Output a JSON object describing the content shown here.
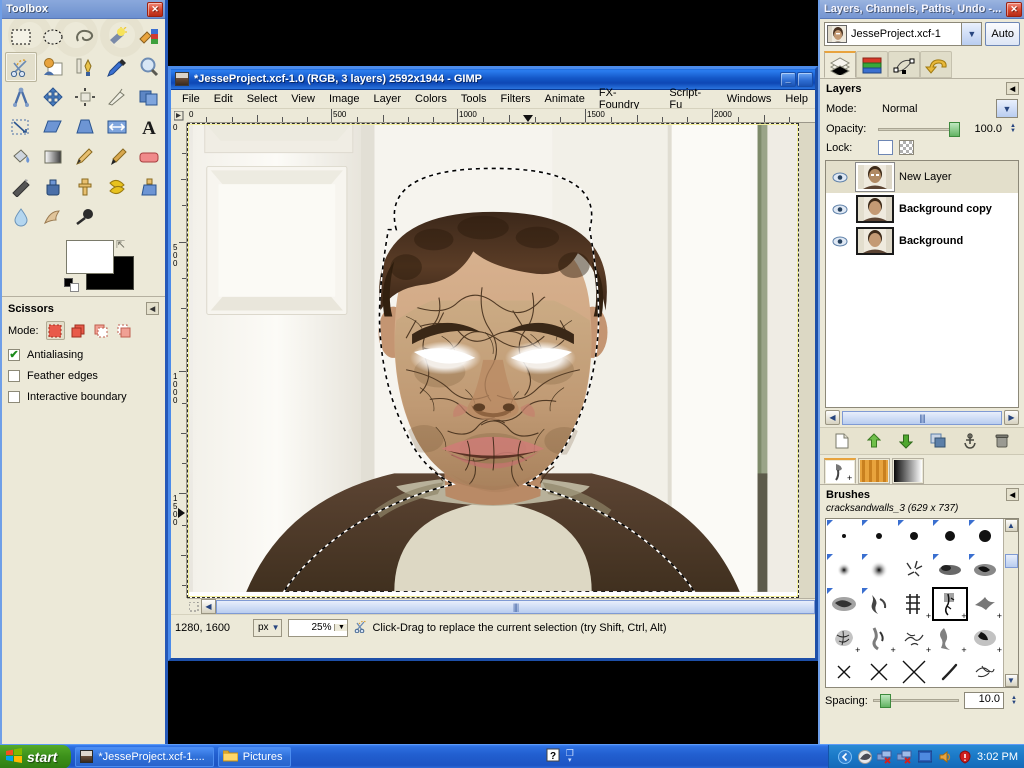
{
  "app": {
    "name": "GIMP",
    "accent": "#1d4fa8",
    "panel_bg": "#ece9d8"
  },
  "toolbox": {
    "title": "Toolbox",
    "close_label": "✕",
    "tools": [
      {
        "name": "rect-select-tool",
        "icon": "rect-select-icon"
      },
      {
        "name": "ellipse-select-tool",
        "icon": "ellipse-select-icon"
      },
      {
        "name": "free-select-tool",
        "icon": "lasso-icon"
      },
      {
        "name": "fuzzy-select-tool",
        "icon": "magic-wand-icon"
      },
      {
        "name": "select-by-color-tool",
        "icon": "color-select-icon"
      },
      {
        "name": "scissors-select-tool",
        "icon": "scissors-icon"
      },
      {
        "name": "foreground-select-tool",
        "icon": "foreground-select-icon"
      },
      {
        "name": "paths-tool",
        "icon": "pen-path-icon"
      },
      {
        "name": "color-picker-tool",
        "icon": "eyedropper-icon"
      },
      {
        "name": "zoom-tool",
        "icon": "magnifier-icon"
      },
      {
        "name": "measure-tool",
        "icon": "compass-icon"
      },
      {
        "name": "move-tool",
        "icon": "move-arrows-icon"
      },
      {
        "name": "align-tool",
        "icon": "align-icon"
      },
      {
        "name": "crop-tool",
        "icon": "crop-knife-icon"
      },
      {
        "name": "rotate-tool",
        "icon": "rotate-icon"
      },
      {
        "name": "scale-tool",
        "icon": "scale-icon"
      },
      {
        "name": "shear-tool",
        "icon": "shear-icon"
      },
      {
        "name": "perspective-tool",
        "icon": "perspective-icon"
      },
      {
        "name": "flip-tool",
        "icon": "flip-icon"
      },
      {
        "name": "text-tool",
        "icon": "text-a-icon"
      },
      {
        "name": "bucket-fill-tool",
        "icon": "bucket-fill-icon"
      },
      {
        "name": "blend-tool",
        "icon": "gradient-icon"
      },
      {
        "name": "pencil-tool",
        "icon": "pencil-icon"
      },
      {
        "name": "paintbrush-tool",
        "icon": "paintbrush-icon"
      },
      {
        "name": "eraser-tool",
        "icon": "eraser-icon"
      },
      {
        "name": "airbrush-tool",
        "icon": "airbrush-icon"
      },
      {
        "name": "ink-tool",
        "icon": "ink-icon"
      },
      {
        "name": "clone-tool",
        "icon": "clone-stamp-icon"
      },
      {
        "name": "heal-tool",
        "icon": "heal-icon"
      },
      {
        "name": "perspective-clone-tool",
        "icon": "perspective-clone-icon"
      },
      {
        "name": "blur-sharpen-tool",
        "icon": "waterdrop-icon"
      },
      {
        "name": "smudge-tool",
        "icon": "smudge-finger-icon"
      },
      {
        "name": "dodge-burn-tool",
        "icon": "dodge-burn-icon"
      }
    ],
    "active_tool_index": 5,
    "colors": {
      "foreground": "#ffffff",
      "background": "#000000"
    },
    "tool_options": {
      "title": "Scissors",
      "mode_label": "Mode:",
      "modes": [
        "replace",
        "add",
        "subtract",
        "intersect"
      ],
      "selected_mode": 0,
      "checkboxes": [
        {
          "label": "Antialiasing",
          "checked": true
        },
        {
          "label": "Feather edges",
          "checked": false
        },
        {
          "label": "Interactive boundary",
          "checked": false
        }
      ]
    }
  },
  "image_window": {
    "title": "*JesseProject.xcf-1.0 (RGB, 3 layers) 2592x1944 - GIMP",
    "minimize_label": "_",
    "maximize_label": "❐",
    "menus": [
      "File",
      "Edit",
      "Select",
      "View",
      "Image",
      "Layer",
      "Colors",
      "Tools",
      "Filters",
      "Animate",
      "FX-Foundry",
      "Script-Fu",
      "Windows",
      "Help"
    ],
    "ruler": {
      "h_ticks": [
        "0",
        "500",
        "1000",
        "1500",
        "2000"
      ],
      "v_ticks": [
        "0",
        "500",
        "1000",
        "1500"
      ],
      "unit": "px"
    },
    "status": {
      "position": "1280, 1600",
      "unit": "px",
      "zoom": "25%",
      "message": "Click-Drag to replace the current selection (try Shift, Ctrl, Alt)",
      "tool_icon": "scissors-icon"
    }
  },
  "dock": {
    "title": "Layers, Channels, Paths, Undo -...",
    "close_label": "✕",
    "image_selector": {
      "value": "JesseProject.xcf-1",
      "auto_label": "Auto",
      "dropdown_icon": "chevron-down-icon"
    },
    "tabs": [
      {
        "name": "layers",
        "icon": "layers-stack-icon",
        "active": true
      },
      {
        "name": "channels",
        "icon": "channels-icon",
        "active": false
      },
      {
        "name": "paths",
        "icon": "paths-icon",
        "active": false
      },
      {
        "name": "undo-history",
        "icon": "undo-arrow-icon",
        "active": false
      }
    ],
    "layers_panel": {
      "title": "Layers",
      "mode_label": "Mode:",
      "mode_value": "Normal",
      "opacity_label": "Opacity:",
      "opacity_value": "100.0",
      "lock_label": "Lock:",
      "layers": [
        {
          "name": "New Layer",
          "visible": true,
          "selected": true
        },
        {
          "name": "Background copy",
          "visible": true,
          "selected": false
        },
        {
          "name": "Background",
          "visible": true,
          "selected": false
        }
      ],
      "buttons": [
        {
          "name": "new-layer-button",
          "icon": "new-page-icon"
        },
        {
          "name": "raise-layer-button",
          "icon": "up-arrow-icon"
        },
        {
          "name": "lower-layer-button",
          "icon": "down-arrow-icon"
        },
        {
          "name": "duplicate-layer-button",
          "icon": "duplicate-icon"
        },
        {
          "name": "anchor-layer-button",
          "icon": "anchor-icon"
        },
        {
          "name": "delete-layer-button",
          "icon": "trash-icon"
        }
      ]
    },
    "brushes_panel": {
      "tabs": [
        {
          "name": "brushes",
          "icon": "brush-swatch-icon",
          "active": true
        },
        {
          "name": "patterns",
          "icon": "pattern-swatch-icon",
          "active": false
        },
        {
          "name": "gradients",
          "icon": "gradient-swatch-icon",
          "active": false
        }
      ],
      "title": "Brushes",
      "selected_brush": "cracksandwalls_3 (629 x 737)",
      "selected_index": 13,
      "spacing_label": "Spacing:",
      "spacing_value": "10.0",
      "brush_cells": [
        {
          "kind": "dot",
          "size": 3,
          "tag": true
        },
        {
          "kind": "dot",
          "size": 5,
          "tag": true
        },
        {
          "kind": "dot",
          "size": 7,
          "tag": true
        },
        {
          "kind": "dot",
          "size": 9,
          "tag": true
        },
        {
          "kind": "dot",
          "size": 11,
          "tag": true
        },
        {
          "kind": "fuzzy",
          "size": 11,
          "tag": true
        },
        {
          "kind": "fuzzy",
          "size": 15,
          "tag": true
        },
        {
          "kind": "splat",
          "size": 20,
          "tag": false
        },
        {
          "kind": "splat",
          "size": 24,
          "tag": true
        },
        {
          "kind": "splat",
          "size": 24,
          "tag": true
        },
        {
          "kind": "splat",
          "size": 26,
          "tag": true
        },
        {
          "kind": "splat",
          "size": 24,
          "tag": true
        },
        {
          "kind": "splat",
          "size": 26,
          "tag": false
        },
        {
          "kind": "crack",
          "size": 26,
          "tag": false
        },
        {
          "kind": "splat",
          "size": 24,
          "tag": false
        },
        {
          "kind": "splat",
          "size": 26,
          "tag": false
        },
        {
          "kind": "splat",
          "size": 24,
          "tag": false
        },
        {
          "kind": "splat",
          "size": 26,
          "tag": false
        },
        {
          "kind": "splat",
          "size": 26,
          "tag": false
        },
        {
          "kind": "splat",
          "size": 22,
          "tag": false
        },
        {
          "kind": "cross",
          "size": 14,
          "tag": false
        },
        {
          "kind": "cross",
          "size": 18,
          "tag": false
        },
        {
          "kind": "cross",
          "size": 24,
          "tag": false
        },
        {
          "kind": "streak",
          "size": 20,
          "tag": false
        },
        {
          "kind": "splat",
          "size": 24,
          "tag": false
        }
      ]
    }
  },
  "taskbar": {
    "start_label": "start",
    "items": [
      {
        "label": "*JesseProject.xcf-1....",
        "icon": "gimp-image-icon",
        "active": true
      },
      {
        "label": "Pictures",
        "icon": "folder-icon",
        "active": false
      }
    ],
    "tray": {
      "clock": "3:02 PM",
      "icons": [
        "help-icon",
        "show-desktop-icon",
        "media-icon",
        "network-disconnected-icon",
        "network-disconnected-2-icon",
        "display-icon",
        "volume-icon",
        "security-alert-icon"
      ]
    }
  }
}
